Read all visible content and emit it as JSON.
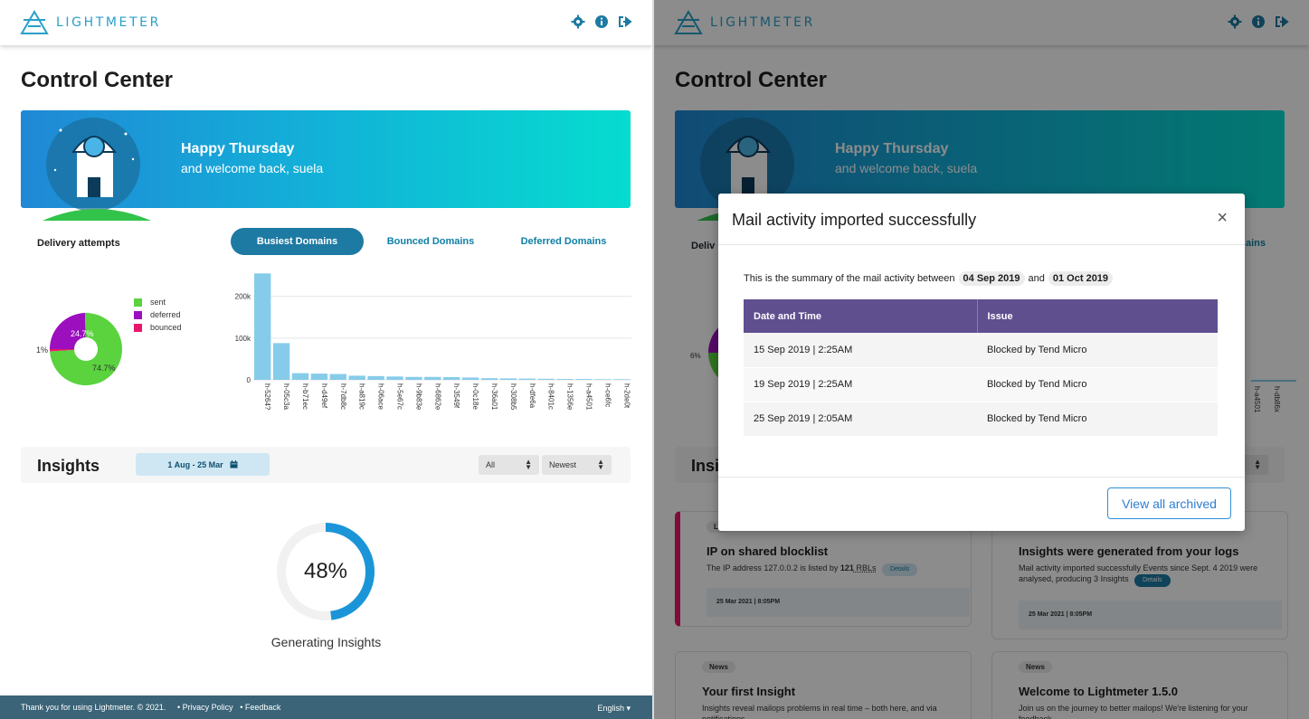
{
  "app": {
    "name": "LIGHTMETER"
  },
  "left": {
    "page_title": "Control Center",
    "banner": {
      "greeting": "Happy Thursday",
      "welcome": "and welcome back, suela"
    },
    "delivery": {
      "title": "Delivery attempts"
    },
    "tabs": [
      {
        "label": "Busiest Domains",
        "active": true
      },
      {
        "label": "Bounced Domains",
        "active": false
      },
      {
        "label": "Deferred Domains",
        "active": false
      }
    ],
    "insights": {
      "title": "Insights",
      "date_range": "1 Aug - 25 Mar",
      "filter": "All",
      "sort": "Newest"
    },
    "progress": {
      "percent_label": "48%",
      "value": 0.48,
      "label": "Generating Insights"
    }
  },
  "chart_data": [
    {
      "type": "pie",
      "title": "Delivery attempts",
      "categories": [
        "sent",
        "deferred",
        "bounced"
      ],
      "values": [
        74.7,
        24.7,
        1
      ],
      "labels": [
        "74.7%",
        "24.7%",
        "1%"
      ],
      "colors": [
        "#5ad33f",
        "#9b0fbf",
        "#e8176a"
      ]
    },
    {
      "type": "bar",
      "categories": [
        "h-5264?",
        "h-05c3a",
        "h-b71ec",
        "h-d49ef",
        "h-7db8c",
        "h-a819c",
        "h-06ace",
        "h-5e67c",
        "h-9b83e",
        "h-6862e",
        "h-3549f",
        "h-0c18e",
        "h-36a01",
        "h-308b5",
        "h-dfe6a",
        "h-8401c",
        "h-1356e",
        "h-a4501",
        "h-ce6fc",
        "h-2de0t"
      ],
      "values": [
        255000,
        88000,
        16000,
        15000,
        14000,
        10000,
        9000,
        8000,
        7000,
        7000,
        6500,
        5500,
        4000,
        3500,
        3000,
        2500,
        2000,
        2000,
        1500,
        1500
      ],
      "yticks": [
        "0",
        "100k",
        "200k"
      ],
      "ylim": [
        0,
        260000
      ],
      "color": "#86ccea"
    }
  ],
  "footer": {
    "thanks": "Thank you for using Lightmeter. © 2021.",
    "privacy": "• Privacy Policy",
    "feedback": "• Feedback",
    "language": "English ▾"
  },
  "right": {
    "background": {
      "page_title": "Control Center",
      "greeting": "Happy Thursday",
      "welcome": "and welcome back, suela",
      "delivery_partial": "Deliv",
      "tab_partial": "ains",
      "pie_label": "6%",
      "bar_labels": [
        "h-a4501",
        "h-db86x"
      ],
      "insights_partial": "Insi",
      "cards": [
        {
          "tag": "Le",
          "title": "IP on shared blocklist",
          "text_pre": "The IP address 127.0.0.2 is listed by ",
          "text_bold": "121",
          "text_post": " RBLs",
          "details": "Details",
          "date": "25 Mar 2021 | 8:05PM"
        },
        {
          "title": "Insights were generated from your logs",
          "text": "Mail activity imported successfully Events since Sept. 4 2019 were analysed, producing 3 Insights",
          "details": "Details",
          "date": "25 Mar 2021 | 8:05PM"
        },
        {
          "tag": "News",
          "title": "Your first Insight",
          "text": "Insights reveal mailops problems in real time – both here, and via notifications"
        },
        {
          "tag": "News",
          "title": "Welcome to Lightmeter 1.5.0",
          "text": "Join us on the journey to better mailops! We're listening for your feedback"
        }
      ]
    },
    "modal": {
      "title": "Mail activity imported successfully",
      "close": "×",
      "summary_text": "This is the summary of the mail activity between",
      "start_date": "04 Sep 2019",
      "and": "and",
      "end_date": "01 Oct 2019",
      "columns": [
        "Date and Time",
        "Issue"
      ],
      "rows": [
        [
          "15 Sep 2019 | 2:25AM",
          "Blocked by Tend Micro"
        ],
        [
          "19 Sep 2019 | 2:25AM",
          "Blocked by Tend Micro"
        ],
        [
          "25 Sep 2019 | 2:05AM",
          "Blocked by Tend Micro"
        ]
      ],
      "archive_button": "View all archived"
    }
  },
  "colors": {
    "accent": "#1d7aa3",
    "logo": "#2aa0c9",
    "table_header": "#5f4f8f",
    "footer": "#3b6478"
  }
}
